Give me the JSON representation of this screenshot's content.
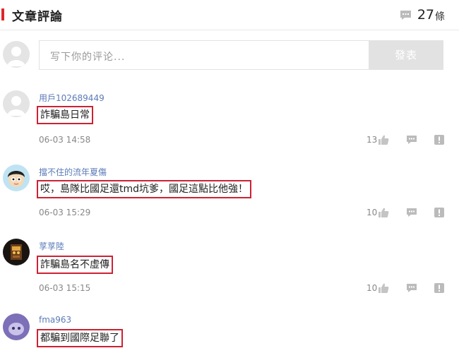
{
  "header": {
    "title": "文章評論",
    "count": "27",
    "count_unit": "條",
    "count_icon": "comment-icon"
  },
  "composer": {
    "placeholder": "写下你的评论...",
    "post_label": "發表"
  },
  "comments": [
    {
      "user": "用戶102689449",
      "text": "詐騙島日常",
      "time": "06-03 14:58",
      "likes": "13",
      "avatar": "default-avatar"
    },
    {
      "user": "擋不住的流年夏傷",
      "text": "哎，島隊比國足還tmd坑爹，國足這點比他強！",
      "time": "06-03 15:29",
      "likes": "10",
      "avatar": "cartoon-boy-avatar"
    },
    {
      "user": "莩莩陸",
      "text": "詐騙島名不虛傳",
      "time": "06-03 15:15",
      "likes": "10",
      "avatar": "dark-character-avatar"
    },
    {
      "user": "fma963",
      "text": "都騙到國際足聯了",
      "avatar": "purple-avatar"
    }
  ],
  "colors": {
    "accent": "#e0232b",
    "highlight_box": "#cc2233",
    "username": "#5b7bb8",
    "post_button": "#e2e2e2"
  }
}
